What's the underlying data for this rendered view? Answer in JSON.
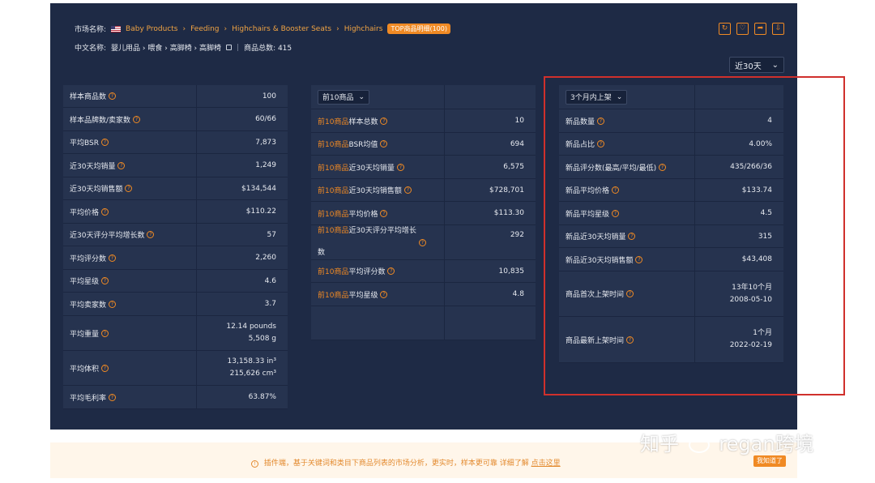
{
  "header": {
    "market_label": "市场名称:",
    "breadcrumb": [
      "Baby Products",
      "Feeding",
      "Highchairs & Booster Seats",
      "Highchairs"
    ],
    "breadcrumb_sep": "›",
    "top_badge": "TOP商品明细(100)",
    "cn_label": "中文名称:",
    "cn_breadcrumb": "婴儿用品 › 喂食 › 高脚椅 › 高脚椅",
    "divider": "|",
    "product_total": "商品总数: 415",
    "flag_icon": "us-flag-icon"
  },
  "toolbar": {
    "icons": [
      "refresh-icon",
      "favorite-icon",
      "share-icon",
      "download-icon"
    ],
    "glyphs": [
      "↻",
      "♡",
      "➦",
      "⇩"
    ]
  },
  "period_select": {
    "value": "近30天"
  },
  "table1": {
    "rows": [
      {
        "label": "样本商品数",
        "value": "100"
      },
      {
        "label": "样本品牌数/卖家数",
        "value": "60/66"
      },
      {
        "label": "平均BSR",
        "value": "7,873"
      },
      {
        "label": "近30天均销量",
        "value": "1,249"
      },
      {
        "label": "近30天均销售额",
        "value": "$134,544"
      },
      {
        "label": "平均价格",
        "value": "$110.22"
      },
      {
        "label": "近30天评分平均增长数",
        "value": "57"
      },
      {
        "label": "平均评分数",
        "value": "2,260"
      },
      {
        "label": "平均星级",
        "value": "4.6"
      },
      {
        "label": "平均卖家数",
        "value": "3.7"
      },
      {
        "label": "平均重量",
        "value": "12.14 pounds",
        "value2": "5,508 g"
      },
      {
        "label": "平均体积",
        "value": "13,158.33 in³",
        "value2": "215,626 cm³"
      },
      {
        "label": "平均毛利率",
        "value": "63.87%"
      }
    ]
  },
  "table2": {
    "select": "前10商品",
    "prefix": "前10商品",
    "rows": [
      {
        "label": "样本总数",
        "value": "10"
      },
      {
        "label": "BSR均值",
        "value": "694"
      },
      {
        "label": "近30天均销量",
        "value": "6,575"
      },
      {
        "label": "近30天均销售额",
        "value": "$728,701"
      },
      {
        "label": "平均价格",
        "value": "$113.30"
      },
      {
        "label": "近30天评分平均增长",
        "label2": "数",
        "value": "292"
      },
      {
        "label": "平均评分数",
        "value": "10,835"
      },
      {
        "label": "平均星级",
        "value": "4.8"
      }
    ]
  },
  "table3": {
    "select": "3个月内上架",
    "rows": [
      {
        "label": "新品数量",
        "value": "4"
      },
      {
        "label": "新品占比",
        "value": "4.00%"
      },
      {
        "label": "新品评分数(最高/平均/最低)",
        "value": "435/266/36"
      },
      {
        "label": "新品平均价格",
        "value": "$133.74"
      },
      {
        "label": "新品平均星级",
        "value": "4.5"
      },
      {
        "label": "新品近30天均销量",
        "value": "315"
      },
      {
        "label": "新品近30天均销售额",
        "value": "$43,408"
      },
      {
        "label": "商品首次上架时间",
        "value": "13年10个月",
        "value2": "2008-05-10"
      },
      {
        "label": "商品最新上架时间",
        "value": "1个月",
        "value2": "2022-02-19"
      }
    ]
  },
  "banner": {
    "text": "插件端，基于关键词和类目下商品列表的市场分析，更实时，样本更可靠   详细了解",
    "link": "点击这里",
    "button": "我知道了"
  },
  "watermark": {
    "left": "知乎",
    "right": "regan跨境"
  },
  "colors": {
    "panel_bg": "#1e2a45",
    "cell_bg": "#26334f",
    "accent": "#f08a24",
    "highlight_box": "#d0302c"
  }
}
